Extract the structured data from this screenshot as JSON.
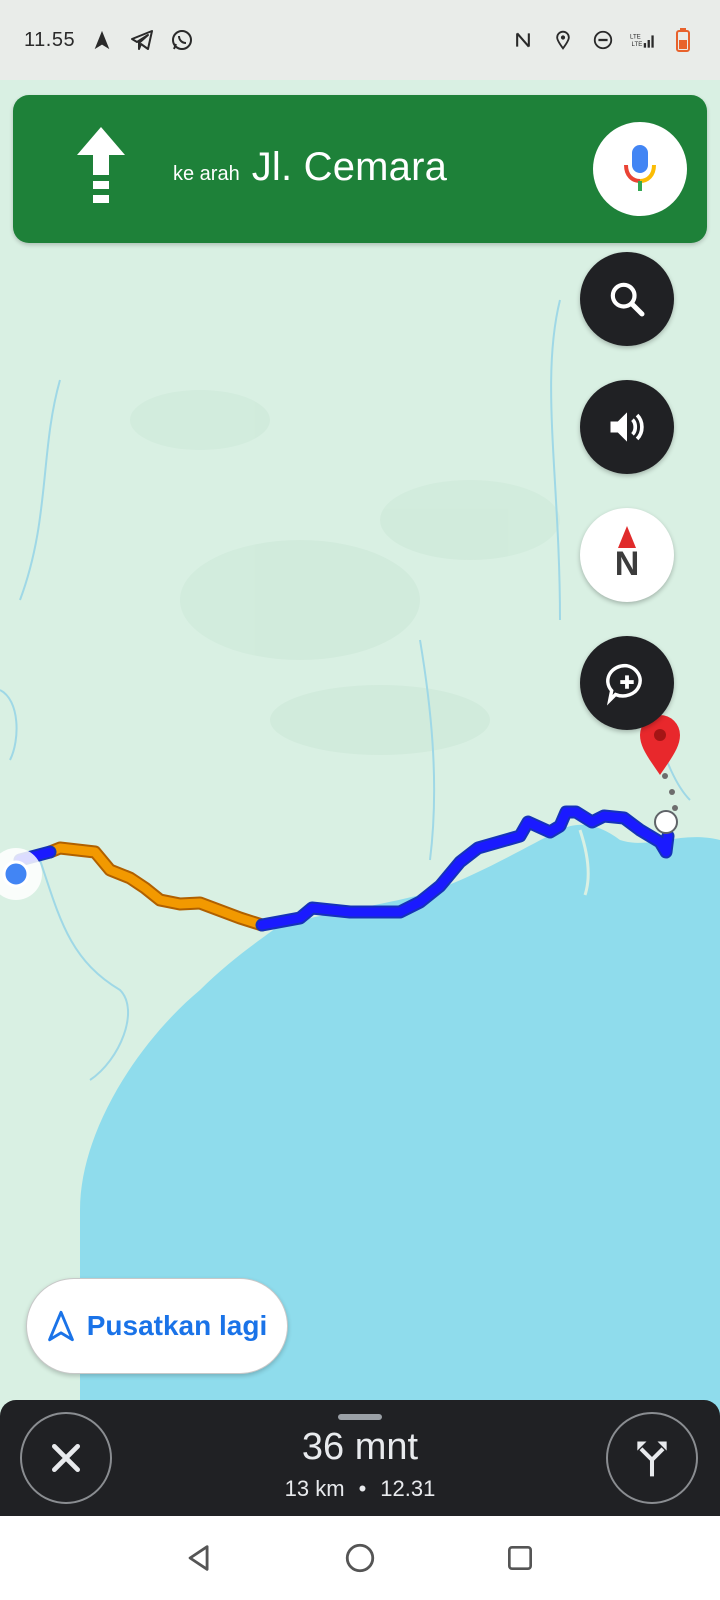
{
  "status_bar": {
    "time": "11.55",
    "left_icons": [
      "navigation-arrow-icon",
      "telegram-icon",
      "whatsapp-icon"
    ],
    "right_icons": [
      "nfc-icon",
      "location-pin-icon",
      "do-not-disturb-icon",
      "lte-signal-icon",
      "battery-icon"
    ]
  },
  "navigation": {
    "maneuver_icon": "straight-arrow-icon",
    "toward_prefix": "ke arah",
    "street": "Jl. Cemara"
  },
  "map_controls": [
    "search-icon",
    "volume-icon",
    "compass-icon",
    "add-comment-icon"
  ],
  "compass": {
    "label": "N"
  },
  "recenter": {
    "label": "Pusatkan lagi"
  },
  "trip": {
    "duration": "36 mnt",
    "distance": "13 km",
    "separator": "•",
    "arrival": "12.31"
  },
  "colors": {
    "banner": "#1e8139",
    "route": "#1a1aff",
    "traffic": "#f29900",
    "land": "#d9f0e3",
    "water": "#8fdcec",
    "accent": "#1a73e8"
  }
}
